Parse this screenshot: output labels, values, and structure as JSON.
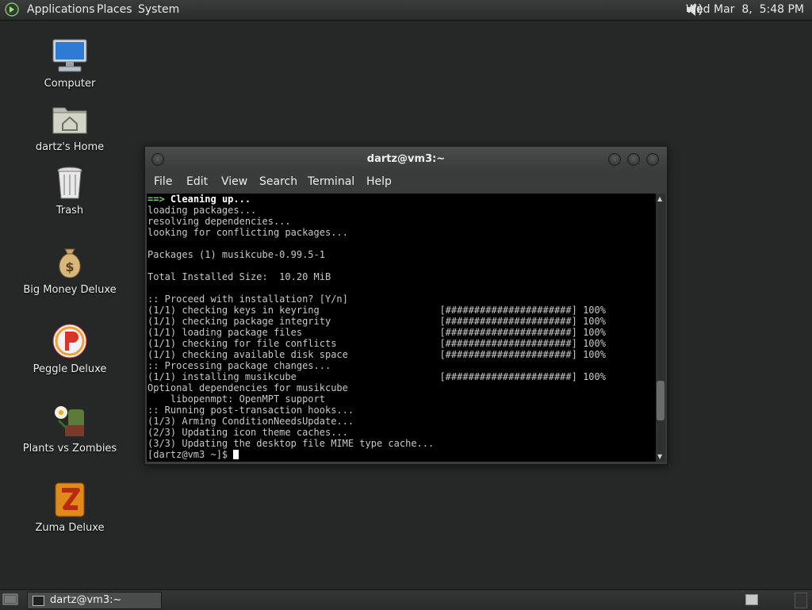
{
  "top_panel": {
    "menus": [
      "Applications",
      "Places",
      "System"
    ],
    "clock": "Wed Mar  8,  5:48 PM",
    "icons": {
      "logo": "gnome-foot-icon",
      "volume": "speaker-icon"
    }
  },
  "desktop": {
    "icons": [
      {
        "label": "Computer",
        "icon": "computer-icon"
      },
      {
        "label": "dartz's Home",
        "icon": "home-folder-icon"
      },
      {
        "label": "Trash",
        "icon": "trash-icon"
      },
      {
        "label": "Big Money Deluxe",
        "icon": "money-bag-icon"
      },
      {
        "label": "Peggle Deluxe",
        "icon": "peggle-icon"
      },
      {
        "label": "Plants vs Zombies",
        "icon": "plants-vs-zombies-icon"
      },
      {
        "label": "Zuma Deluxe",
        "icon": "zuma-icon"
      }
    ]
  },
  "terminal": {
    "title": "dartz@vm3:~",
    "menu": [
      "File",
      "Edit",
      "View",
      "Search",
      "Terminal",
      "Help"
    ],
    "first_line": {
      "arrow": "==>",
      "text": "Cleaning up..."
    },
    "lines": [
      "loading packages...",
      "resolving dependencies...",
      "looking for conflicting packages...",
      "",
      "Packages (1) musikcube-0.99.5-1",
      "",
      "Total Installed Size:  10.20 MiB",
      "",
      ":: Proceed with installation? [Y/n]",
      "(1/1) checking keys in keyring                     [######################] 100%",
      "(1/1) checking package integrity                   [######################] 100%",
      "(1/1) loading package files                        [######################] 100%",
      "(1/1) checking for file conflicts                  [######################] 100%",
      "(1/1) checking available disk space                [######################] 100%",
      ":: Processing package changes...",
      "(1/1) installing musikcube                         [######################] 100%",
      "Optional dependencies for musikcube",
      "    libopenmpt: OpenMPT support",
      ":: Running post-transaction hooks...",
      "(1/3) Arming ConditionNeedsUpdate...",
      "(2/3) Updating icon theme caches...",
      "(3/3) Updating the desktop file MIME type cache..."
    ],
    "prompt": "[dartz@vm3 ~]$ ",
    "scroll_position": 0.85
  },
  "bottom_panel": {
    "task_label": "dartz@vm3:~",
    "icons": {
      "show_desktop": "show-desktop-icon",
      "workspace": "workspace-switcher-icon",
      "trash": "trash-applet-icon"
    }
  }
}
